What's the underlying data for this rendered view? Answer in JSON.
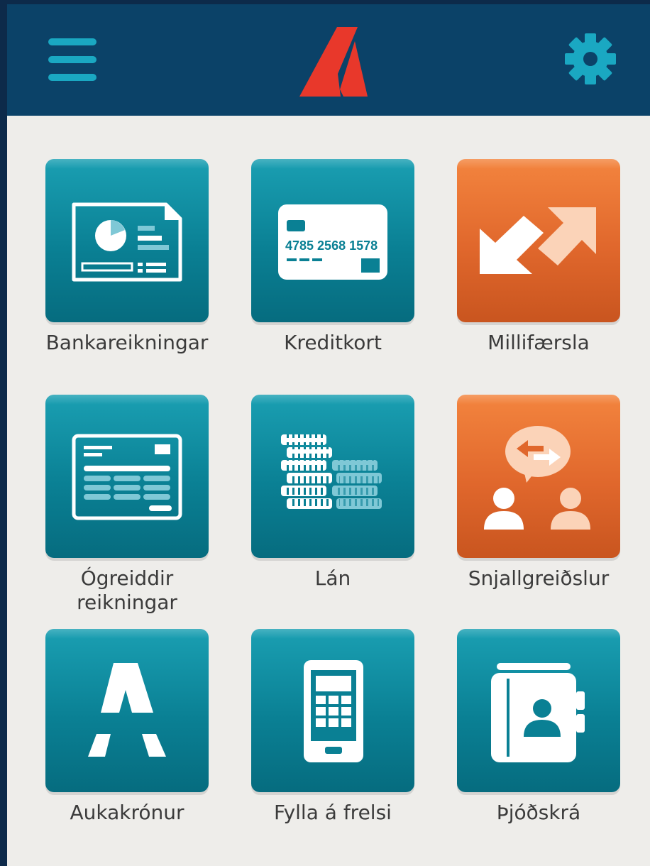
{
  "header": {
    "menu_icon": "hamburger-menu-icon",
    "logo_icon": "landsbankinn-logo-icon",
    "settings_icon": "gear-icon",
    "background_color": "#0b4268",
    "accent_color": "#1aa8c2",
    "logo_color": "#e8382b"
  },
  "tiles": [
    {
      "label": "Bankareikningar",
      "icon": "account-statement-icon",
      "color": "teal"
    },
    {
      "label": "Kreditkort",
      "icon": "credit-card-icon",
      "color": "teal",
      "card_number": "4785 2568 1578"
    },
    {
      "label": "Millifærsla",
      "icon": "transfer-arrows-icon",
      "color": "orange"
    },
    {
      "label": "Ógreiddir\nreikningar",
      "icon": "unpaid-bill-icon",
      "color": "teal"
    },
    {
      "label": "Lán",
      "icon": "coin-stacks-icon",
      "color": "teal"
    },
    {
      "label": "Snjallgreiðslur",
      "icon": "people-exchange-icon",
      "color": "orange"
    },
    {
      "label": "Aukakrónur",
      "icon": "aukakronur-logo-icon",
      "color": "teal"
    },
    {
      "label": "Fylla á frelsi",
      "icon": "mobile-phone-icon",
      "color": "teal"
    },
    {
      "label": "Þjóðskrá",
      "icon": "contact-book-icon",
      "color": "teal"
    }
  ],
  "colors": {
    "teal": "#0a8094",
    "orange": "#e0672c",
    "page_background": "#eeedea",
    "label_text": "#3b3b3b"
  }
}
